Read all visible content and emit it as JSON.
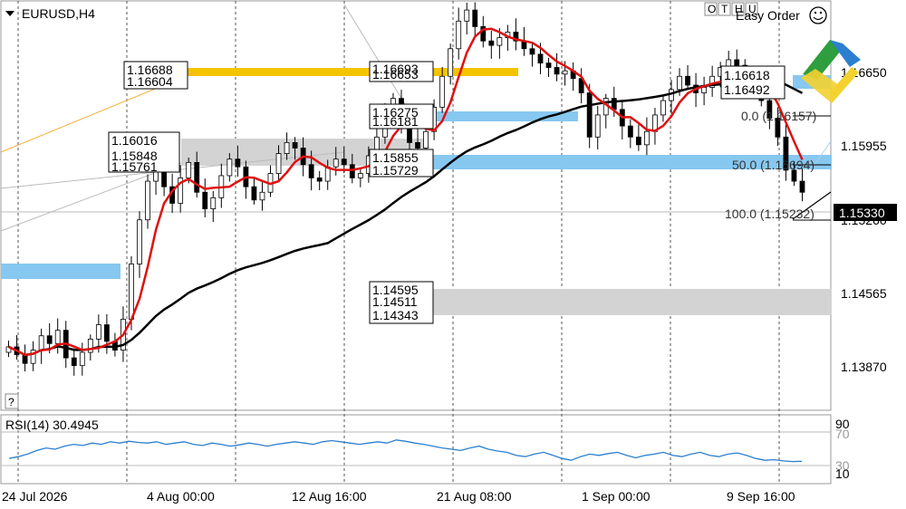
{
  "header": {
    "symbol_title": "EURUSD,H4",
    "easy_order_label": "Easy Order",
    "toolbar_letters": [
      "O",
      "T",
      "H",
      "U"
    ]
  },
  "price_axis": {
    "ticks": [
      "1.16650",
      "1.15955",
      "1.15260",
      "1.14565",
      "1.13870"
    ],
    "current_price": "1.15330"
  },
  "rsi": {
    "title": "RSI(14) 30.4945",
    "levels": [
      "90",
      "70",
      "30",
      "10"
    ]
  },
  "time_axis": {
    "ticks": [
      "24 Jul 2026",
      "4 Aug 00:00",
      "12 Aug 16:00",
      "21 Aug 08:00",
      "1 Sep 00:00",
      "9 Sep 16:00"
    ]
  },
  "question_label": "?",
  "level_labels": {
    "group1": [
      "1.16688",
      "1.16604"
    ],
    "group2": [
      "1.16016",
      "1.15848",
      "1.15761"
    ],
    "group3": [
      "1.16693",
      "1.16653"
    ],
    "group4": [
      "1.16275",
      "1.16181"
    ],
    "group5": [
      "1.15855",
      "1.15729"
    ],
    "group6": [
      "1.14595",
      "1.14511",
      "1.14343"
    ],
    "group7": [
      "1.16618",
      "1.16492"
    ]
  },
  "fibo_labels": [
    "0.0 (1.16157)",
    "50.0 (1.15694)",
    "100.0 (1.15232)"
  ],
  "colors": {
    "candle": "#000000",
    "ma_fast": "#e01010",
    "ma_slow": "#000000",
    "zone_blue": "#87c8f0",
    "zone_gray": "#d3d3d3",
    "zone_yellow": "#f5c400",
    "rsi_line": "#2c7fd0",
    "grid": "#cccccc"
  },
  "chart_data": [
    {
      "type": "candlestick",
      "title": "EURUSD,H4",
      "x": [
        "24 Jul 2026",
        "4 Aug 00:00",
        "12 Aug 16:00",
        "21 Aug 08:00",
        "1 Sep 00:00",
        "9 Sep 16:00"
      ],
      "ylim": [
        1.134,
        1.1705
      ],
      "close": [
        1.1395,
        1.1388,
        1.138,
        1.1392,
        1.1405,
        1.1398,
        1.141,
        1.1385,
        1.1378,
        1.139,
        1.1402,
        1.1415,
        1.14,
        1.1392,
        1.142,
        1.147,
        1.151,
        1.1545,
        1.156,
        1.154,
        1.1525,
        1.1548,
        1.1562,
        1.1535,
        1.152,
        1.153,
        1.155,
        1.1565,
        1.1558,
        1.154,
        1.1528,
        1.1535,
        1.1552,
        1.157,
        1.158,
        1.1575,
        1.156,
        1.1548,
        1.1545,
        1.1558,
        1.1565,
        1.156,
        1.1548,
        1.1552,
        1.1568,
        1.1585,
        1.1605,
        1.162,
        1.1598,
        1.158,
        1.1575,
        1.159,
        1.1612,
        1.164,
        1.1665,
        1.169,
        1.17,
        1.1685,
        1.1672,
        1.1668,
        1.1675,
        1.168,
        1.1672,
        1.1665,
        1.166,
        1.1652,
        1.1648,
        1.1642,
        1.1645,
        1.1638,
        1.1625,
        1.1585,
        1.1605,
        1.162,
        1.161,
        1.1595,
        1.1585,
        1.1578,
        1.159,
        1.1605,
        1.1618,
        1.1628,
        1.164,
        1.1632,
        1.1625,
        1.163,
        1.164,
        1.1648,
        1.1655,
        1.165,
        1.164,
        1.1632,
        1.1618,
        1.1602,
        1.1585,
        1.1555,
        1.1545,
        1.1535
      ],
      "ma_fast_label": "red moving average",
      "ma_slow_label": "black moving average"
    },
    {
      "type": "line",
      "title": "RSI(14) 30.4945",
      "ylim": [
        0,
        100
      ],
      "values": [
        35,
        38,
        42,
        48,
        52,
        50,
        55,
        58,
        56,
        60,
        58,
        62,
        60,
        63,
        61,
        60,
        62,
        58,
        60,
        62,
        58,
        56,
        60,
        58,
        55,
        57,
        60,
        58,
        55,
        58,
        60,
        62,
        60,
        58,
        62,
        64,
        62,
        60,
        58,
        60,
        62,
        60,
        65,
        63,
        60,
        58,
        55,
        52,
        50,
        48,
        52,
        55,
        50,
        47,
        45,
        40,
        38,
        42,
        45,
        40,
        35,
        32,
        38,
        42,
        40,
        43,
        45,
        40,
        36,
        40,
        42,
        45,
        40,
        38,
        42,
        45,
        40,
        38,
        42,
        44,
        40,
        35,
        32,
        33,
        31,
        30,
        30.5
      ],
      "levels": [
        10,
        30,
        70,
        90
      ]
    }
  ]
}
